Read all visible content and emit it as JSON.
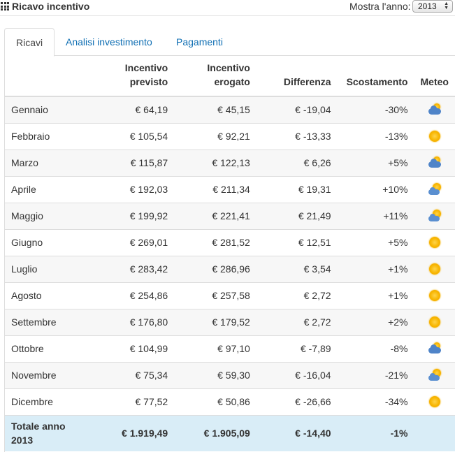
{
  "header": {
    "title": "Ricavo incentivo",
    "grid_icon": "grid-icon",
    "year_label": "Mostra l'anno:",
    "year_selected": "2013"
  },
  "tabs": [
    {
      "label": "Ricavi",
      "active": true
    },
    {
      "label": "Analisi investimento",
      "active": false
    },
    {
      "label": "Pagamenti",
      "active": false
    }
  ],
  "table": {
    "headers": {
      "previsto": [
        "Incentivo",
        "previsto"
      ],
      "erogato": [
        "Incentivo",
        "erogato"
      ],
      "differenza": "Differenza",
      "scostamento": "Scostamento",
      "meteo": "Meteo"
    },
    "rows": [
      {
        "mese": "Gennaio",
        "previsto": "€ 64,19",
        "erogato": "€ 45,15",
        "differenza": "€ -19,04",
        "scostamento": "-30%",
        "meteo": "cloudy"
      },
      {
        "mese": "Febbraio",
        "previsto": "€ 105,54",
        "erogato": "€ 92,21",
        "differenza": "€ -13,33",
        "scostamento": "-13%",
        "meteo": "sunny"
      },
      {
        "mese": "Marzo",
        "previsto": "€ 115,87",
        "erogato": "€ 122,13",
        "differenza": "€ 6,26",
        "scostamento": "+5%",
        "meteo": "cloudy"
      },
      {
        "mese": "Aprile",
        "previsto": "€ 192,03",
        "erogato": "€ 211,34",
        "differenza": "€ 19,31",
        "scostamento": "+10%",
        "meteo": "partly"
      },
      {
        "mese": "Maggio",
        "previsto": "€ 199,92",
        "erogato": "€ 221,41",
        "differenza": "€ 21,49",
        "scostamento": "+11%",
        "meteo": "partly"
      },
      {
        "mese": "Giugno",
        "previsto": "€ 269,01",
        "erogato": "€ 281,52",
        "differenza": "€ 12,51",
        "scostamento": "+5%",
        "meteo": "sunny"
      },
      {
        "mese": "Luglio",
        "previsto": "€ 283,42",
        "erogato": "€ 286,96",
        "differenza": "€ 3,54",
        "scostamento": "+1%",
        "meteo": "sunny"
      },
      {
        "mese": "Agosto",
        "previsto": "€ 254,86",
        "erogato": "€ 257,58",
        "differenza": "€ 2,72",
        "scostamento": "+1%",
        "meteo": "sunny"
      },
      {
        "mese": "Settembre",
        "previsto": "€ 176,80",
        "erogato": "€ 179,52",
        "differenza": "€ 2,72",
        "scostamento": "+2%",
        "meteo": "sunny"
      },
      {
        "mese": "Ottobre",
        "previsto": "€ 104,99",
        "erogato": "€ 97,10",
        "differenza": "€ -7,89",
        "scostamento": "-8%",
        "meteo": "cloudy"
      },
      {
        "mese": "Novembre",
        "previsto": "€ 75,34",
        "erogato": "€ 59,30",
        "differenza": "€ -16,04",
        "scostamento": "-21%",
        "meteo": "partly"
      },
      {
        "mese": "Dicembre",
        "previsto": "€ 77,52",
        "erogato": "€ 50,86",
        "differenza": "€ -26,66",
        "scostamento": "-34%",
        "meteo": "sunny"
      }
    ],
    "total": {
      "label": [
        "Totale anno",
        "2013"
      ],
      "previsto": "€ 1.919,49",
      "erogato": "€ 1.905,09",
      "differenza": "€ -14,40",
      "scostamento": "-1%"
    }
  },
  "colors": {
    "link": "#0e6eb3",
    "total_row_bg": "#d9edf7",
    "stripe_bg": "#f7f7f7",
    "sun": "#f7b500",
    "cloud": "#4f84c8"
  }
}
